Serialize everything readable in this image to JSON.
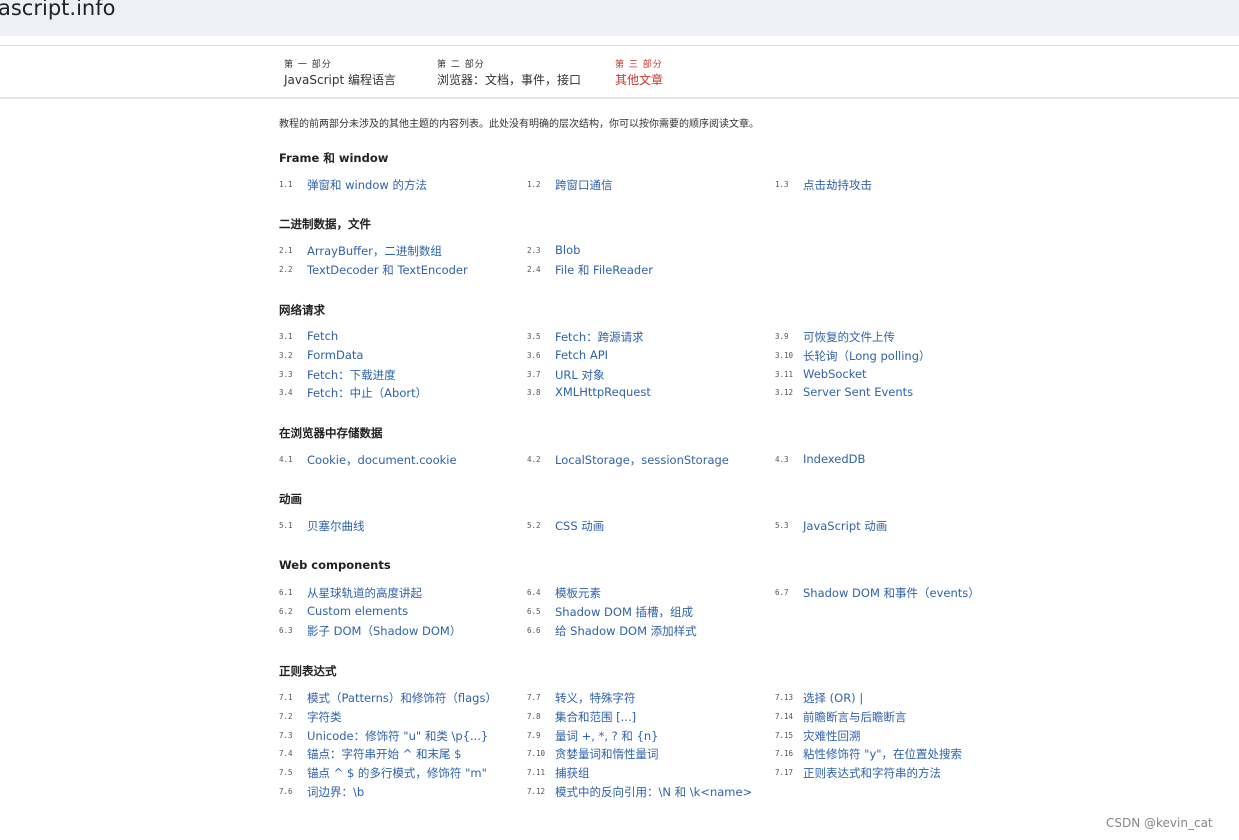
{
  "site": {
    "title": "ascript.info"
  },
  "tabs": [
    {
      "num": "第 一 部分",
      "label": "JavaScript 编程语言",
      "active": false
    },
    {
      "num": "第 二 部分",
      "label": "浏览器：文档，事件，接口",
      "active": false
    },
    {
      "num": "第 三 部分",
      "label": "其他文章",
      "active": true
    }
  ],
  "intro": "教程的前两部分未涉及的其他主题的内容列表。此处没有明确的层次结构，你可以按你需要的顺序阅读文章。",
  "sections": [
    {
      "title": "Frame 和 window",
      "columns": [
        [
          {
            "num": "1.1",
            "title": "弹窗和 window 的方法"
          }
        ],
        [
          {
            "num": "1.2",
            "title": "跨窗口通信"
          }
        ],
        [
          {
            "num": "1.3",
            "title": "点击劫持攻击"
          }
        ]
      ]
    },
    {
      "title": "二进制数据，文件",
      "columns": [
        [
          {
            "num": "2.1",
            "title": "ArrayBuffer，二进制数组"
          },
          {
            "num": "2.2",
            "title": "TextDecoder 和 TextEncoder"
          }
        ],
        [
          {
            "num": "2.3",
            "title": "Blob"
          },
          {
            "num": "2.4",
            "title": "File 和 FileReader"
          }
        ],
        []
      ]
    },
    {
      "title": "网络请求",
      "columns": [
        [
          {
            "num": "3.1",
            "title": "Fetch"
          },
          {
            "num": "3.2",
            "title": "FormData"
          },
          {
            "num": "3.3",
            "title": "Fetch：下载进度"
          },
          {
            "num": "3.4",
            "title": "Fetch：中止（Abort）"
          }
        ],
        [
          {
            "num": "3.5",
            "title": "Fetch：跨源请求"
          },
          {
            "num": "3.6",
            "title": "Fetch API"
          },
          {
            "num": "3.7",
            "title": "URL 对象"
          },
          {
            "num": "3.8",
            "title": "XMLHttpRequest"
          }
        ],
        [
          {
            "num": "3.9",
            "title": "可恢复的文件上传"
          },
          {
            "num": "3.10",
            "title": "长轮询（Long polling）"
          },
          {
            "num": "3.11",
            "title": "WebSocket"
          },
          {
            "num": "3.12",
            "title": "Server Sent Events"
          }
        ]
      ]
    },
    {
      "title": "在浏览器中存储数据",
      "columns": [
        [
          {
            "num": "4.1",
            "title": "Cookie，document.cookie"
          }
        ],
        [
          {
            "num": "4.2",
            "title": "LocalStorage，sessionStorage"
          }
        ],
        [
          {
            "num": "4.3",
            "title": "IndexedDB"
          }
        ]
      ]
    },
    {
      "title": "动画",
      "columns": [
        [
          {
            "num": "5.1",
            "title": "贝塞尔曲线"
          }
        ],
        [
          {
            "num": "5.2",
            "title": "CSS 动画"
          }
        ],
        [
          {
            "num": "5.3",
            "title": "JavaScript 动画"
          }
        ]
      ]
    },
    {
      "title": "Web components",
      "columns": [
        [
          {
            "num": "6.1",
            "title": "从星球轨道的高度讲起"
          },
          {
            "num": "6.2",
            "title": "Custom elements"
          },
          {
            "num": "6.3",
            "title": "影子 DOM（Shadow DOM）"
          }
        ],
        [
          {
            "num": "6.4",
            "title": "模板元素"
          },
          {
            "num": "6.5",
            "title": "Shadow DOM 插槽，组成"
          },
          {
            "num": "6.6",
            "title": "给 Shadow DOM 添加样式"
          }
        ],
        [
          {
            "num": "6.7",
            "title": "Shadow DOM 和事件（events）"
          }
        ]
      ]
    },
    {
      "title": "正则表达式",
      "columns": [
        [
          {
            "num": "7.1",
            "title": "模式（Patterns）和修饰符（flags）"
          },
          {
            "num": "7.2",
            "title": "字符类"
          },
          {
            "num": "7.3",
            "title": "Unicode：修饰符 \"u\" 和类 \\p{...}"
          },
          {
            "num": "7.4",
            "title": "锚点：字符串开始 ^ 和末尾 $"
          },
          {
            "num": "7.5",
            "title": "锚点 ^ $ 的多行模式，修饰符 \"m\""
          },
          {
            "num": "7.6",
            "title": "词边界：\\b"
          }
        ],
        [
          {
            "num": "7.7",
            "title": "转义，特殊字符"
          },
          {
            "num": "7.8",
            "title": "集合和范围 [...]"
          },
          {
            "num": "7.9",
            "title": "量词 +, *, ? 和 {n}"
          },
          {
            "num": "7.10",
            "title": "贪婪量词和惰性量词"
          },
          {
            "num": "7.11",
            "title": "捕获组"
          },
          {
            "num": "7.12",
            "title": "模式中的反向引用：\\N 和 \\k<name>"
          }
        ],
        [
          {
            "num": "7.13",
            "title": "选择 (OR) |"
          },
          {
            "num": "7.14",
            "title": "前瞻断言与后瞻断言"
          },
          {
            "num": "7.15",
            "title": "灾难性回溯"
          },
          {
            "num": "7.16",
            "title": "粘性修饰符 \"y\"，在位置处搜索"
          },
          {
            "num": "7.17",
            "title": "正则表达式和字符串的方法"
          }
        ]
      ]
    }
  ],
  "watermark": "CSDN @kevin_cat"
}
